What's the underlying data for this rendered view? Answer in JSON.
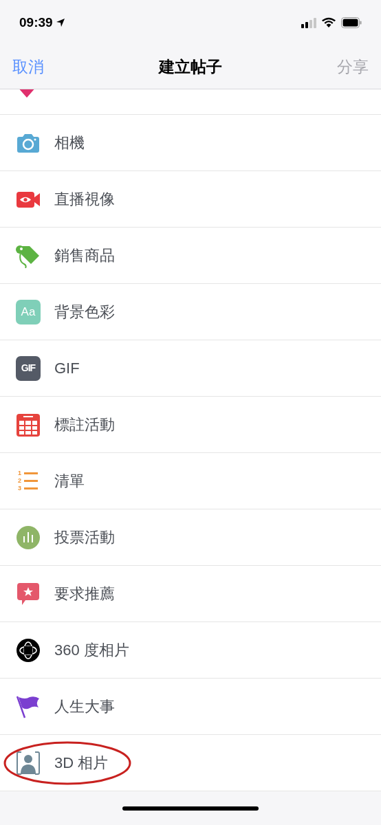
{
  "status_bar": {
    "time": "09:39"
  },
  "nav": {
    "cancel": "取消",
    "title": "建立帖子",
    "share": {
      "label": "分享",
      "disabled": true
    }
  },
  "partial_item": {
    "kind": "heart"
  },
  "items": [
    {
      "kind": "camera",
      "label": "相機",
      "highlighted": false
    },
    {
      "kind": "live",
      "label": "直播視像",
      "highlighted": false
    },
    {
      "kind": "tag",
      "label": "銷售商品",
      "highlighted": false
    },
    {
      "kind": "background",
      "label": "背景色彩",
      "badge": "Aa",
      "highlighted": false
    },
    {
      "kind": "gif",
      "label": "GIF",
      "badge": "GIF",
      "highlighted": false
    },
    {
      "kind": "event",
      "label": "標註活動",
      "highlighted": false
    },
    {
      "kind": "list",
      "label": "清單",
      "numbers": [
        "1",
        "2",
        "3"
      ],
      "highlighted": false
    },
    {
      "kind": "poll",
      "label": "投票活動",
      "highlighted": false
    },
    {
      "kind": "recommend",
      "label": "要求推薦",
      "highlighted": false
    },
    {
      "kind": "photo360",
      "label": "360 度相片",
      "highlighted": false
    },
    {
      "kind": "life_event",
      "label": "人生大事",
      "highlighted": false
    },
    {
      "kind": "photo3d",
      "label": "3D 相片",
      "highlighted": true
    }
  ]
}
